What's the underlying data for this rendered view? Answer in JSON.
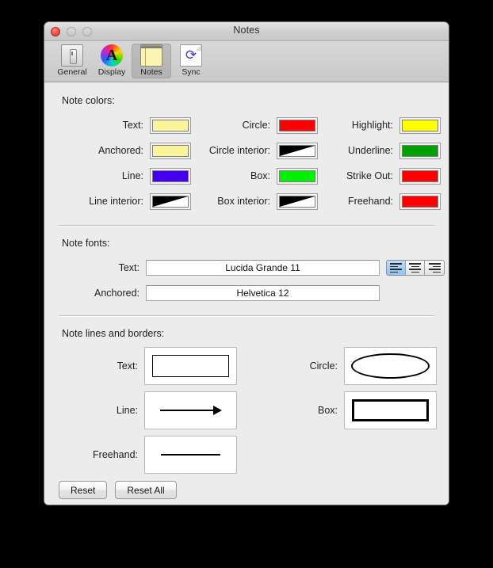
{
  "window": {
    "title": "Notes",
    "traffic_lights": [
      "close",
      "minimize",
      "zoom"
    ]
  },
  "toolbar": {
    "items": [
      {
        "label": "General",
        "icon": "switch-icon",
        "selected": false
      },
      {
        "label": "Display",
        "icon": "color-wheel-a-icon",
        "selected": false
      },
      {
        "label": "Notes",
        "icon": "yellow-notepad-icon",
        "selected": true
      },
      {
        "label": "Sync",
        "icon": "sync-arrows-page-icon",
        "selected": false
      }
    ]
  },
  "note_colors": {
    "heading": "Note colors:",
    "rows": [
      [
        {
          "label": "Text:",
          "color": "#F8F59A",
          "transparent": false
        },
        {
          "label": "Circle:",
          "color": "#FF0000",
          "transparent": false
        },
        {
          "label": "Highlight:",
          "color": "#FFFF00",
          "transparent": false
        }
      ],
      [
        {
          "label": "Anchored:",
          "color": "#F8F59A",
          "transparent": false
        },
        {
          "label": "Circle interior:",
          "color": "transparent",
          "transparent": true
        },
        {
          "label": "Underline:",
          "color": "#00A000",
          "transparent": false
        }
      ],
      [
        {
          "label": "Line:",
          "color": "#4400EE",
          "transparent": false
        },
        {
          "label": "Box:",
          "color": "#00F000",
          "transparent": false
        },
        {
          "label": "Strike Out:",
          "color": "#FF0000",
          "transparent": false
        }
      ],
      [
        {
          "label": "Line interior:",
          "color": "transparent",
          "transparent": true
        },
        {
          "label": "Box interior:",
          "color": "transparent",
          "transparent": true
        },
        {
          "label": "Freehand:",
          "color": "#FF0000",
          "transparent": false
        }
      ]
    ]
  },
  "note_fonts": {
    "heading": "Note fonts:",
    "text_label": "Text:",
    "text_value": "Lucida Grande 11",
    "anchored_label": "Anchored:",
    "anchored_value": "Helvetica 12",
    "alignment": {
      "options": [
        "align-left",
        "align-center",
        "align-right"
      ],
      "selected": "align-left"
    }
  },
  "note_lines": {
    "heading": "Note lines and borders:",
    "left": [
      {
        "label": "Text:",
        "preview": "thin-rectangle"
      },
      {
        "label": "Line:",
        "preview": "arrow"
      },
      {
        "label": "Freehand:",
        "preview": "straight-line"
      }
    ],
    "right": [
      {
        "label": "Circle:",
        "preview": "ellipse"
      },
      {
        "label": "Box:",
        "preview": "thick-rectangle"
      }
    ]
  },
  "footer": {
    "reset_label": "Reset",
    "reset_all_label": "Reset All"
  }
}
